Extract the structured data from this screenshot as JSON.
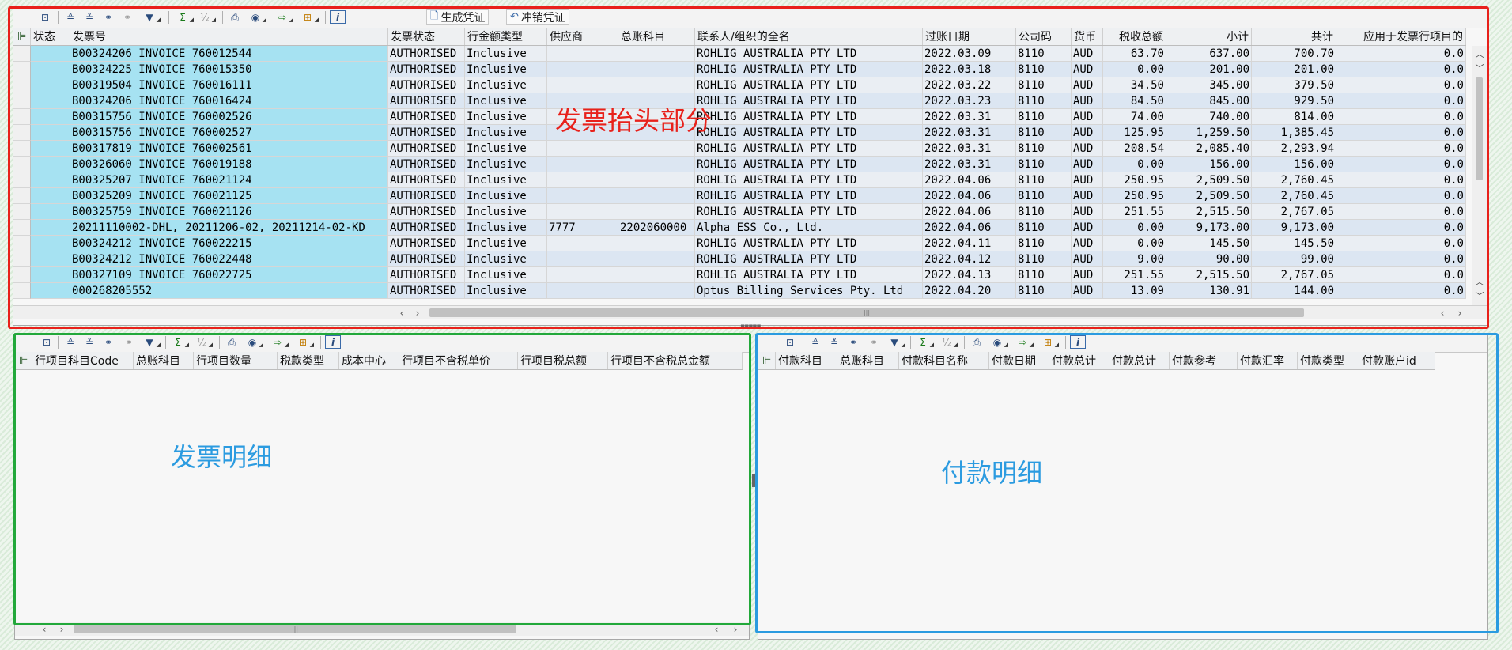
{
  "toolbar_icons": {
    "detail": "detail-icon",
    "sort_asc": "sort-ascending-icon",
    "sort_desc": "sort-descending-icon",
    "find": "binoculars-icon",
    "find_next": "find-next-icon",
    "filter": "filter-icon",
    "sum": "sigma-icon",
    "subtotal": "subtotal-icon",
    "print": "print-icon",
    "views": "views-icon",
    "export": "export-icon",
    "layout": "layout-icon",
    "info": "info-icon"
  },
  "top_toolbar": {
    "generate_label": "生成凭证",
    "reverse_label": "冲销凭证"
  },
  "header_table": {
    "columns": [
      "状态",
      "发票号",
      "发票状态",
      "行金额类型",
      "供应商",
      "总账科目",
      "联系人/组织的全名",
      "过账日期",
      "公司码",
      "货币",
      "税收总额",
      "小计",
      "共计",
      "应用于发票行项目的"
    ],
    "rows": [
      [
        "",
        "B00324206 INVOICE 760012544",
        "AUTHORISED",
        "Inclusive",
        "",
        "",
        "ROHLIG AUSTRALIA PTY LTD",
        "2022.03.09",
        "8110",
        "AUD",
        "63.70",
        "637.00",
        "700.70",
        "0.0"
      ],
      [
        "",
        "B00324225 INVOICE 760015350",
        "AUTHORISED",
        "Inclusive",
        "",
        "",
        "ROHLIG AUSTRALIA PTY LTD",
        "2022.03.18",
        "8110",
        "AUD",
        "0.00",
        "201.00",
        "201.00",
        "0.0"
      ],
      [
        "",
        "B00319504 INVOICE 760016111",
        "AUTHORISED",
        "Inclusive",
        "",
        "",
        "ROHLIG AUSTRALIA PTY LTD",
        "2022.03.22",
        "8110",
        "AUD",
        "34.50",
        "345.00",
        "379.50",
        "0.0"
      ],
      [
        "",
        "B00324206 INVOICE 760016424",
        "AUTHORISED",
        "Inclusive",
        "",
        "",
        "ROHLIG AUSTRALIA PTY LTD",
        "2022.03.23",
        "8110",
        "AUD",
        "84.50",
        "845.00",
        "929.50",
        "0.0"
      ],
      [
        "",
        "B00315756 INVOICE 760002526",
        "AUTHORISED",
        "Inclusive",
        "",
        "",
        "ROHLIG AUSTRALIA PTY LTD",
        "2022.03.31",
        "8110",
        "AUD",
        "74.00",
        "740.00",
        "814.00",
        "0.0"
      ],
      [
        "",
        "B00315756 INVOICE 760002527",
        "AUTHORISED",
        "Inclusive",
        "",
        "",
        "ROHLIG AUSTRALIA PTY LTD",
        "2022.03.31",
        "8110",
        "AUD",
        "125.95",
        "1,259.50",
        "1,385.45",
        "0.0"
      ],
      [
        "",
        "B00317819 INVOICE 760002561",
        "AUTHORISED",
        "Inclusive",
        "",
        "",
        "ROHLIG AUSTRALIA PTY LTD",
        "2022.03.31",
        "8110",
        "AUD",
        "208.54",
        "2,085.40",
        "2,293.94",
        "0.0"
      ],
      [
        "",
        "B00326060 INVOICE 760019188",
        "AUTHORISED",
        "Inclusive",
        "",
        "",
        "ROHLIG AUSTRALIA PTY LTD",
        "2022.03.31",
        "8110",
        "AUD",
        "0.00",
        "156.00",
        "156.00",
        "0.0"
      ],
      [
        "",
        "B00325207 INVOICE 760021124",
        "AUTHORISED",
        "Inclusive",
        "",
        "",
        "ROHLIG AUSTRALIA PTY LTD",
        "2022.04.06",
        "8110",
        "AUD",
        "250.95",
        "2,509.50",
        "2,760.45",
        "0.0"
      ],
      [
        "",
        "B00325209 INVOICE 760021125",
        "AUTHORISED",
        "Inclusive",
        "",
        "",
        "ROHLIG AUSTRALIA PTY LTD",
        "2022.04.06",
        "8110",
        "AUD",
        "250.95",
        "2,509.50",
        "2,760.45",
        "0.0"
      ],
      [
        "",
        "B00325759 INVOICE 760021126",
        "AUTHORISED",
        "Inclusive",
        "",
        "",
        "ROHLIG AUSTRALIA PTY LTD",
        "2022.04.06",
        "8110",
        "AUD",
        "251.55",
        "2,515.50",
        "2,767.05",
        "0.0"
      ],
      [
        "",
        "20211110002-DHL, 20211206-02, 20211214-02-KD",
        "AUTHORISED",
        "Inclusive",
        "7777",
        "2202060000",
        "Alpha ESS Co., Ltd.",
        "2022.04.06",
        "8110",
        "AUD",
        "0.00",
        "9,173.00",
        "9,173.00",
        "0.0"
      ],
      [
        "",
        "B00324212 INVOICE 760022215",
        "AUTHORISED",
        "Inclusive",
        "",
        "",
        "ROHLIG AUSTRALIA PTY LTD",
        "2022.04.11",
        "8110",
        "AUD",
        "0.00",
        "145.50",
        "145.50",
        "0.0"
      ],
      [
        "",
        "B00324212 INVOICE 760022448",
        "AUTHORISED",
        "Inclusive",
        "",
        "",
        "ROHLIG AUSTRALIA PTY LTD",
        "2022.04.12",
        "8110",
        "AUD",
        "9.00",
        "90.00",
        "99.00",
        "0.0"
      ],
      [
        "",
        "B00327109 INVOICE 760022725",
        "AUTHORISED",
        "Inclusive",
        "",
        "",
        "ROHLIG AUSTRALIA PTY LTD",
        "2022.04.13",
        "8110",
        "AUD",
        "251.55",
        "2,515.50",
        "2,767.05",
        "0.0"
      ],
      [
        "",
        "000268205552",
        "AUTHORISED",
        "Inclusive",
        "",
        "",
        "Optus Billing Services Pty. Ltd",
        "2022.04.20",
        "8110",
        "AUD",
        "13.09",
        "130.91",
        "144.00",
        "0.0"
      ]
    ]
  },
  "detail_table": {
    "columns": [
      "行项目科目Code",
      "总账科目",
      "行项目数量",
      "税款类型",
      "成本中心",
      "行项目不含税单价",
      "行项目税总额",
      "行项目不含税总金额"
    ]
  },
  "payment_table": {
    "columns": [
      "付款科目",
      "总账科目",
      "付款科目名称",
      "付款日期",
      "付款总计",
      "付款总计",
      "付款参考",
      "付款汇率",
      "付款类型",
      "付款账户id"
    ]
  },
  "annotations": {
    "header_label": "发票抬头部分",
    "detail_label": "发票明细",
    "payment_label": "付款明细",
    "header_color": "#e8211b",
    "detail_color": "#22a83a",
    "payment_color": "#2b9be0"
  }
}
